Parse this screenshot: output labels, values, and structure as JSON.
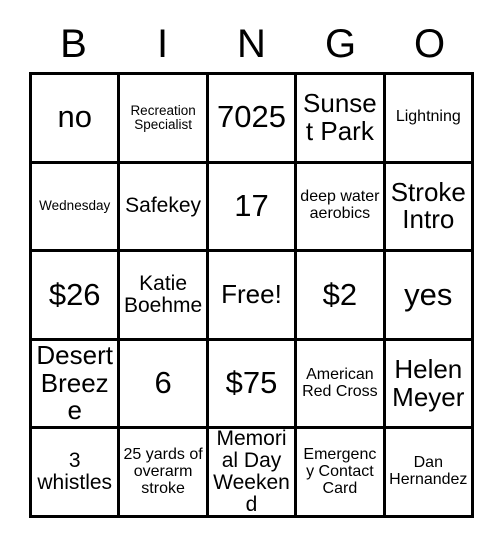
{
  "card": {
    "headers": [
      "B",
      "I",
      "N",
      "G",
      "O"
    ],
    "rows": [
      [
        {
          "text": "no",
          "size": "fs-xl"
        },
        {
          "text": "Recreation Specialist",
          "size": "fs-xs"
        },
        {
          "text": "7025",
          "size": "fs-xl"
        },
        {
          "text": "Sunset Park",
          "size": "fs-lg"
        },
        {
          "text": "Lightning",
          "size": "fs-sm"
        }
      ],
      [
        {
          "text": "Wednesday",
          "size": "fs-xs"
        },
        {
          "text": "Safekey",
          "size": "fs-md"
        },
        {
          "text": "17",
          "size": "fs-xl"
        },
        {
          "text": "deep water aerobics",
          "size": "fs-sm"
        },
        {
          "text": "Stroke Intro",
          "size": "fs-lg"
        }
      ],
      [
        {
          "text": "$26",
          "size": "fs-xl"
        },
        {
          "text": "Katie Boehme",
          "size": "fs-md"
        },
        {
          "text": "Free!",
          "size": "fs-lg"
        },
        {
          "text": "$2",
          "size": "fs-xl"
        },
        {
          "text": "yes",
          "size": "fs-xl"
        }
      ],
      [
        {
          "text": "Desert Breeze",
          "size": "fs-lg"
        },
        {
          "text": "6",
          "size": "fs-xl"
        },
        {
          "text": "$75",
          "size": "fs-xl"
        },
        {
          "text": "American Red Cross",
          "size": "fs-sm"
        },
        {
          "text": "Helen Meyer",
          "size": "fs-lg"
        }
      ],
      [
        {
          "text": "3 whistles",
          "size": "fs-md"
        },
        {
          "text": "25 yards of overarm stroke",
          "size": "fs-sm"
        },
        {
          "text": "Memorial Day Weekend",
          "size": "fs-md"
        },
        {
          "text": "Emergency Contact Card",
          "size": "fs-sm"
        },
        {
          "text": "Dan Hernandez",
          "size": "fs-sm"
        }
      ]
    ]
  }
}
